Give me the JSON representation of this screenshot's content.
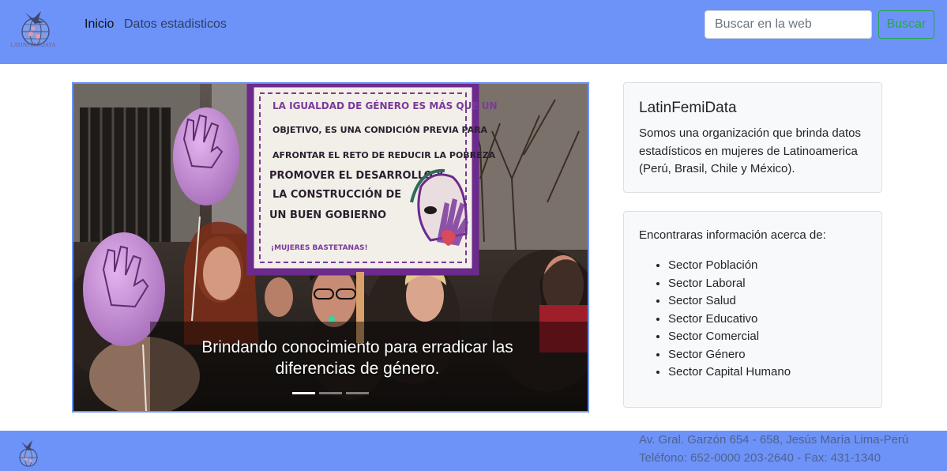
{
  "brand": {
    "logo_text": "LATINFEMIDATA",
    "logo_icon": "globe-bird-logo-icon"
  },
  "nav": {
    "home": "Inicio",
    "stats": "Datos estadisticos"
  },
  "search": {
    "placeholder": "Buscar en la web",
    "button": "Buscar"
  },
  "carousel": {
    "caption_line1": "Brindando conocimiento para erradicar las",
    "caption_line2": "diferencias de género.",
    "slides": 3,
    "active_slide": 1,
    "sign": {
      "line1": "LA IGUALDAD DE GÉNERO ES MÁS QUE UN",
      "line2": "OBJETIVO, ES UNA CONDICIÓN PREVIA PARA",
      "line3": "AFRONTAR EL RETO DE REDUCIR LA POBREZA",
      "line4": "PROMOVER EL DESARROLLO Y",
      "line5": "LA CONSTRUCCIÓN DE",
      "line6": "UN BUEN GOBIERNO",
      "signature": "¡MUJERES BASTETANAS!"
    }
  },
  "about": {
    "title": "LatinFemiData",
    "text": "Somos una organización que brinda datos estadísticos en mujeres de Latinoamerica (Perú, Brasil, Chile y México)."
  },
  "info": {
    "intro": "Encontraras información acerca de:",
    "sectors": [
      "Sector Población",
      "Sector Laboral",
      "Sector Salud",
      "Sector Educativo",
      "Sector Comercial",
      "Sector Género",
      "Sector Capital Humano"
    ]
  },
  "footer": {
    "address": "Av. Gral. Garzón 654 - 658, Jesús María Lima-Perú",
    "phone": "Teléfono: 652-0000 203-2640 - Fax: 431-1340"
  },
  "colors": {
    "navbar": "#6d93f8",
    "success": "#28a745",
    "card_bg": "#f8f9fa",
    "balloon": "#c98ad6",
    "sign_border": "#6b2a8c"
  }
}
